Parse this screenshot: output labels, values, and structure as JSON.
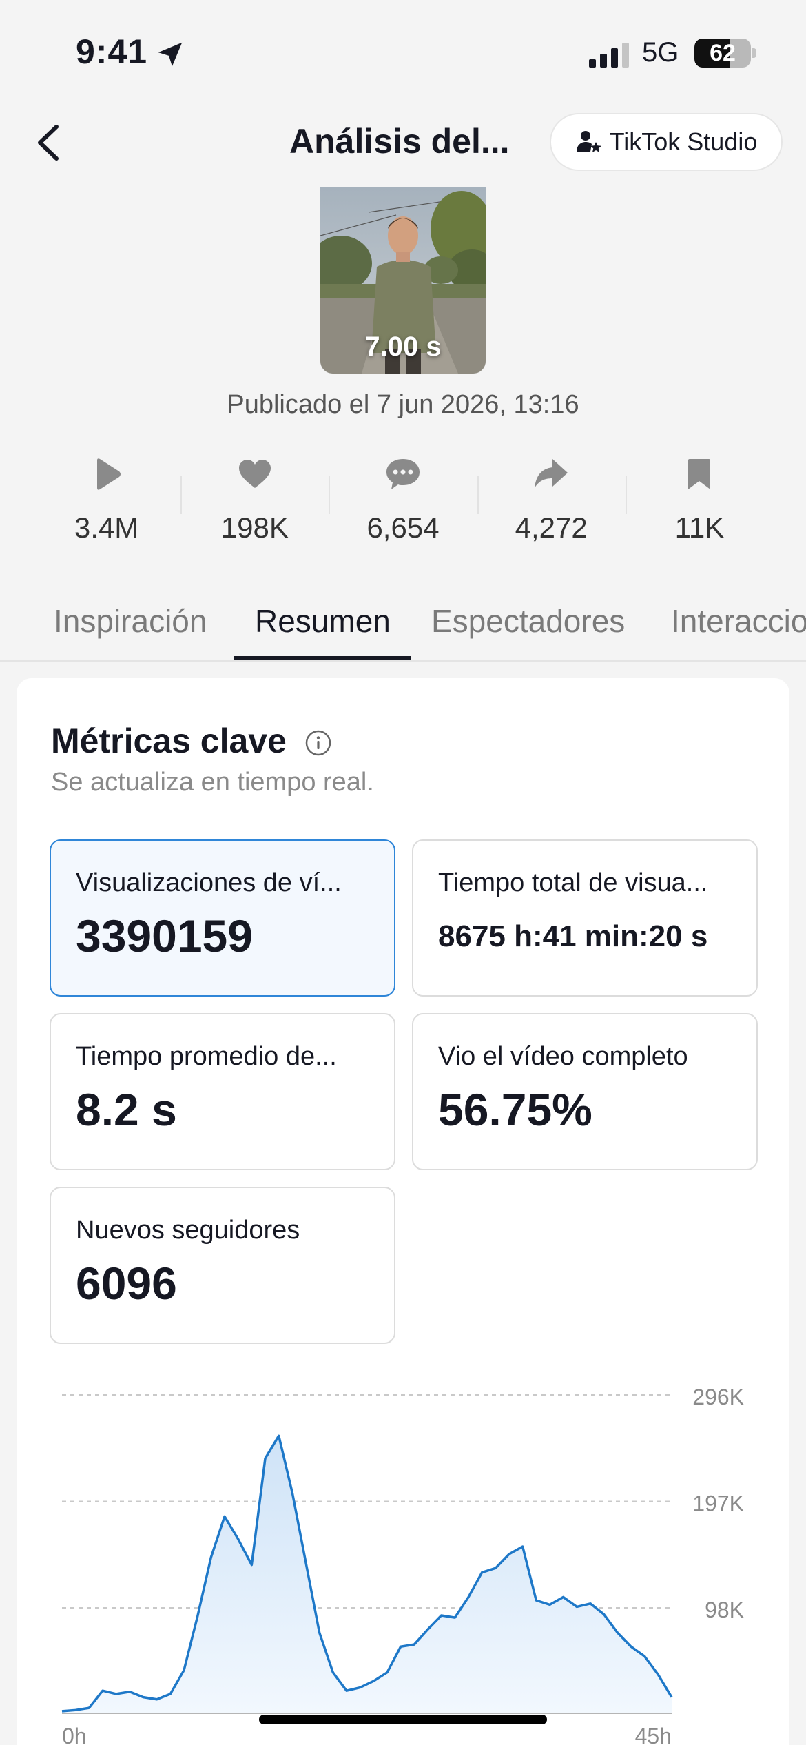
{
  "status_bar": {
    "time": "9:41",
    "network": "5G",
    "battery": {
      "label": "62",
      "level": 0.62
    }
  },
  "header": {
    "title": "Análisis del...",
    "studio_button": "TikTok Studio"
  },
  "video": {
    "duration": "7.00 s",
    "published": "Publicado el 7 jun 2026, 13:16"
  },
  "stats": [
    {
      "icon": "play-icon",
      "value": "3.4M"
    },
    {
      "icon": "heart-icon",
      "value": "198K"
    },
    {
      "icon": "comment-icon",
      "value": "6,654"
    },
    {
      "icon": "share-icon",
      "value": "4,272"
    },
    {
      "icon": "bookmark-icon",
      "value": "11K"
    }
  ],
  "tabs": [
    {
      "label": "Inspiración",
      "active": false
    },
    {
      "label": "Resumen",
      "active": true
    },
    {
      "label": "Espectadores",
      "active": false
    },
    {
      "label": "Interacciones",
      "active": false
    }
  ],
  "metrics_card": {
    "title": "Métricas clave",
    "subtitle": "Se actualiza en tiempo real.",
    "metrics": [
      {
        "label": "Visualizaciones de ví...",
        "value": "3390159",
        "selected": true
      },
      {
        "label": "Tiempo total de visua...",
        "value": "8675 h:41 min:20 s",
        "selected": false
      },
      {
        "label": "Tiempo promedio de...",
        "value": "8.2 s",
        "selected": false
      },
      {
        "label": "Vio el vídeo completo",
        "value": "56.75%",
        "selected": false
      },
      {
        "label": "Nuevos seguidores",
        "value": "6096",
        "selected": false
      }
    ]
  },
  "chart_data": {
    "type": "area",
    "color": "#1e78c8",
    "ylim": [
      0,
      296000
    ],
    "y_ticks": [
      "296K",
      "197K",
      "98K"
    ],
    "y_tick_values": [
      296000,
      197000,
      98000
    ],
    "x_tick_labels": [
      "0h",
      "45h"
    ],
    "x": [
      0,
      1,
      2,
      3,
      4,
      5,
      6,
      7,
      8,
      9,
      10,
      11,
      12,
      13,
      14,
      15,
      16,
      17,
      18,
      19,
      20,
      21,
      22,
      23,
      24,
      25,
      26,
      27,
      28,
      29,
      30,
      31,
      32,
      33,
      34,
      35,
      36,
      37,
      38,
      39,
      40,
      41,
      42,
      43,
      44,
      45
    ],
    "values": [
      2000,
      3000,
      5000,
      21000,
      18000,
      20000,
      15000,
      13000,
      18000,
      40000,
      90000,
      145000,
      183000,
      162000,
      138000,
      237000,
      258000,
      205000,
      140000,
      75000,
      38000,
      21000,
      24000,
      30000,
      38000,
      62000,
      64000,
      78000,
      91000,
      89000,
      108000,
      131000,
      135000,
      148000,
      155000,
      105000,
      101000,
      108000,
      99000,
      102000,
      92000,
      75000,
      62000,
      53000,
      36000,
      15000
    ]
  }
}
